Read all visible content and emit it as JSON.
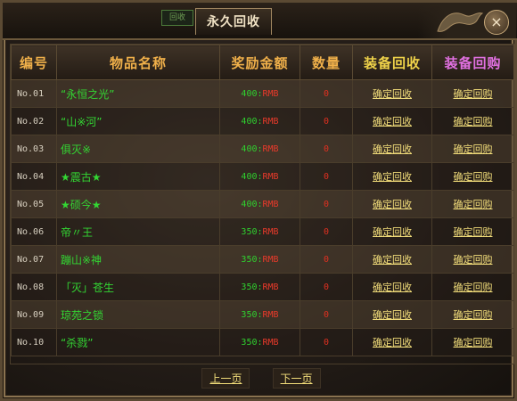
{
  "window": {
    "title": "永久回收",
    "small_tab": "回收"
  },
  "headers": [
    "编号",
    "物品名称",
    "奖励金额",
    "数量",
    "装备回收",
    "装备回购"
  ],
  "rows": [
    {
      "no": "No.01",
      "name": "“永恒之光”",
      "reward": "400:",
      "unit": "RMB",
      "qty": "0",
      "recycle": "确定回收",
      "buyback": "确定回购"
    },
    {
      "no": "No.02",
      "name": "“山※河”",
      "reward": "400:",
      "unit": "RMB",
      "qty": "0",
      "recycle": "确定回收",
      "buyback": "确定回购"
    },
    {
      "no": "No.03",
      "name": "俱灭※",
      "reward": "400:",
      "unit": "RMB",
      "qty": "0",
      "recycle": "确定回收",
      "buyback": "确定回购"
    },
    {
      "no": "No.04",
      "name": "★震古★",
      "reward": "400:",
      "unit": "RMB",
      "qty": "0",
      "recycle": "确定回收",
      "buyback": "确定回购"
    },
    {
      "no": "No.05",
      "name": "★硕今★",
      "reward": "400:",
      "unit": "RMB",
      "qty": "0",
      "recycle": "确定回收",
      "buyback": "确定回购"
    },
    {
      "no": "No.06",
      "name": "帝〃王",
      "reward": "350:",
      "unit": "RMB",
      "qty": "0",
      "recycle": "确定回收",
      "buyback": "确定回购"
    },
    {
      "no": "No.07",
      "name": "蹦山※神",
      "reward": "350:",
      "unit": "RMB",
      "qty": "0",
      "recycle": "确定回收",
      "buyback": "确定回购"
    },
    {
      "no": "No.08",
      "name": "「灭」苍生",
      "reward": "350:",
      "unit": "RMB",
      "qty": "0",
      "recycle": "确定回收",
      "buyback": "确定回购"
    },
    {
      "no": "No.09",
      "name": "琼苑之锁",
      "reward": "350:",
      "unit": "RMB",
      "qty": "0",
      "recycle": "确定回收",
      "buyback": "确定回购"
    },
    {
      "no": "No.10",
      "name": "“杀戮”",
      "reward": "350:",
      "unit": "RMB",
      "qty": "0",
      "recycle": "确定回收",
      "buyback": "确定回购"
    }
  ],
  "pager": {
    "prev": "上一页",
    "next": "下一页"
  },
  "close_label": "×"
}
